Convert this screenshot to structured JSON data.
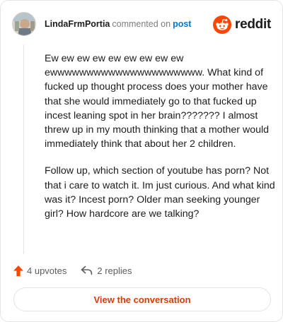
{
  "comment": {
    "username": "LindaFrmPortia",
    "action_text": "commented on",
    "post_link": "post",
    "paragraphs": [
      "Ew ew ew ew ew ew ew ew ew ewwwwwwwwwwwwwwwwwwwww. What kind of fucked up thought process does your mother have that she would immediately go to that fucked up incest leaning spot in her brain??????? I almost threw up in my mouth thinking that a mother would immediately think that about her 2 children.",
      "Follow up, which section of youtube has porn? Not that i care to watch it. Im just curious. And what kind was it? Incest porn? Older man seeking younger girl? How hardcore are we talking?"
    ]
  },
  "brand": {
    "name": "reddit",
    "color": "#ff4500"
  },
  "actions": {
    "upvotes_label": "4 upvotes",
    "replies_label": "2 replies",
    "upvote_color": "#ff4500"
  },
  "cta": {
    "label": "View the conversation",
    "color": "#d93a00"
  },
  "icons": [
    "avatar",
    "reddit-logo-icon",
    "upvote-arrow-icon",
    "reply-arrow-icon"
  ]
}
